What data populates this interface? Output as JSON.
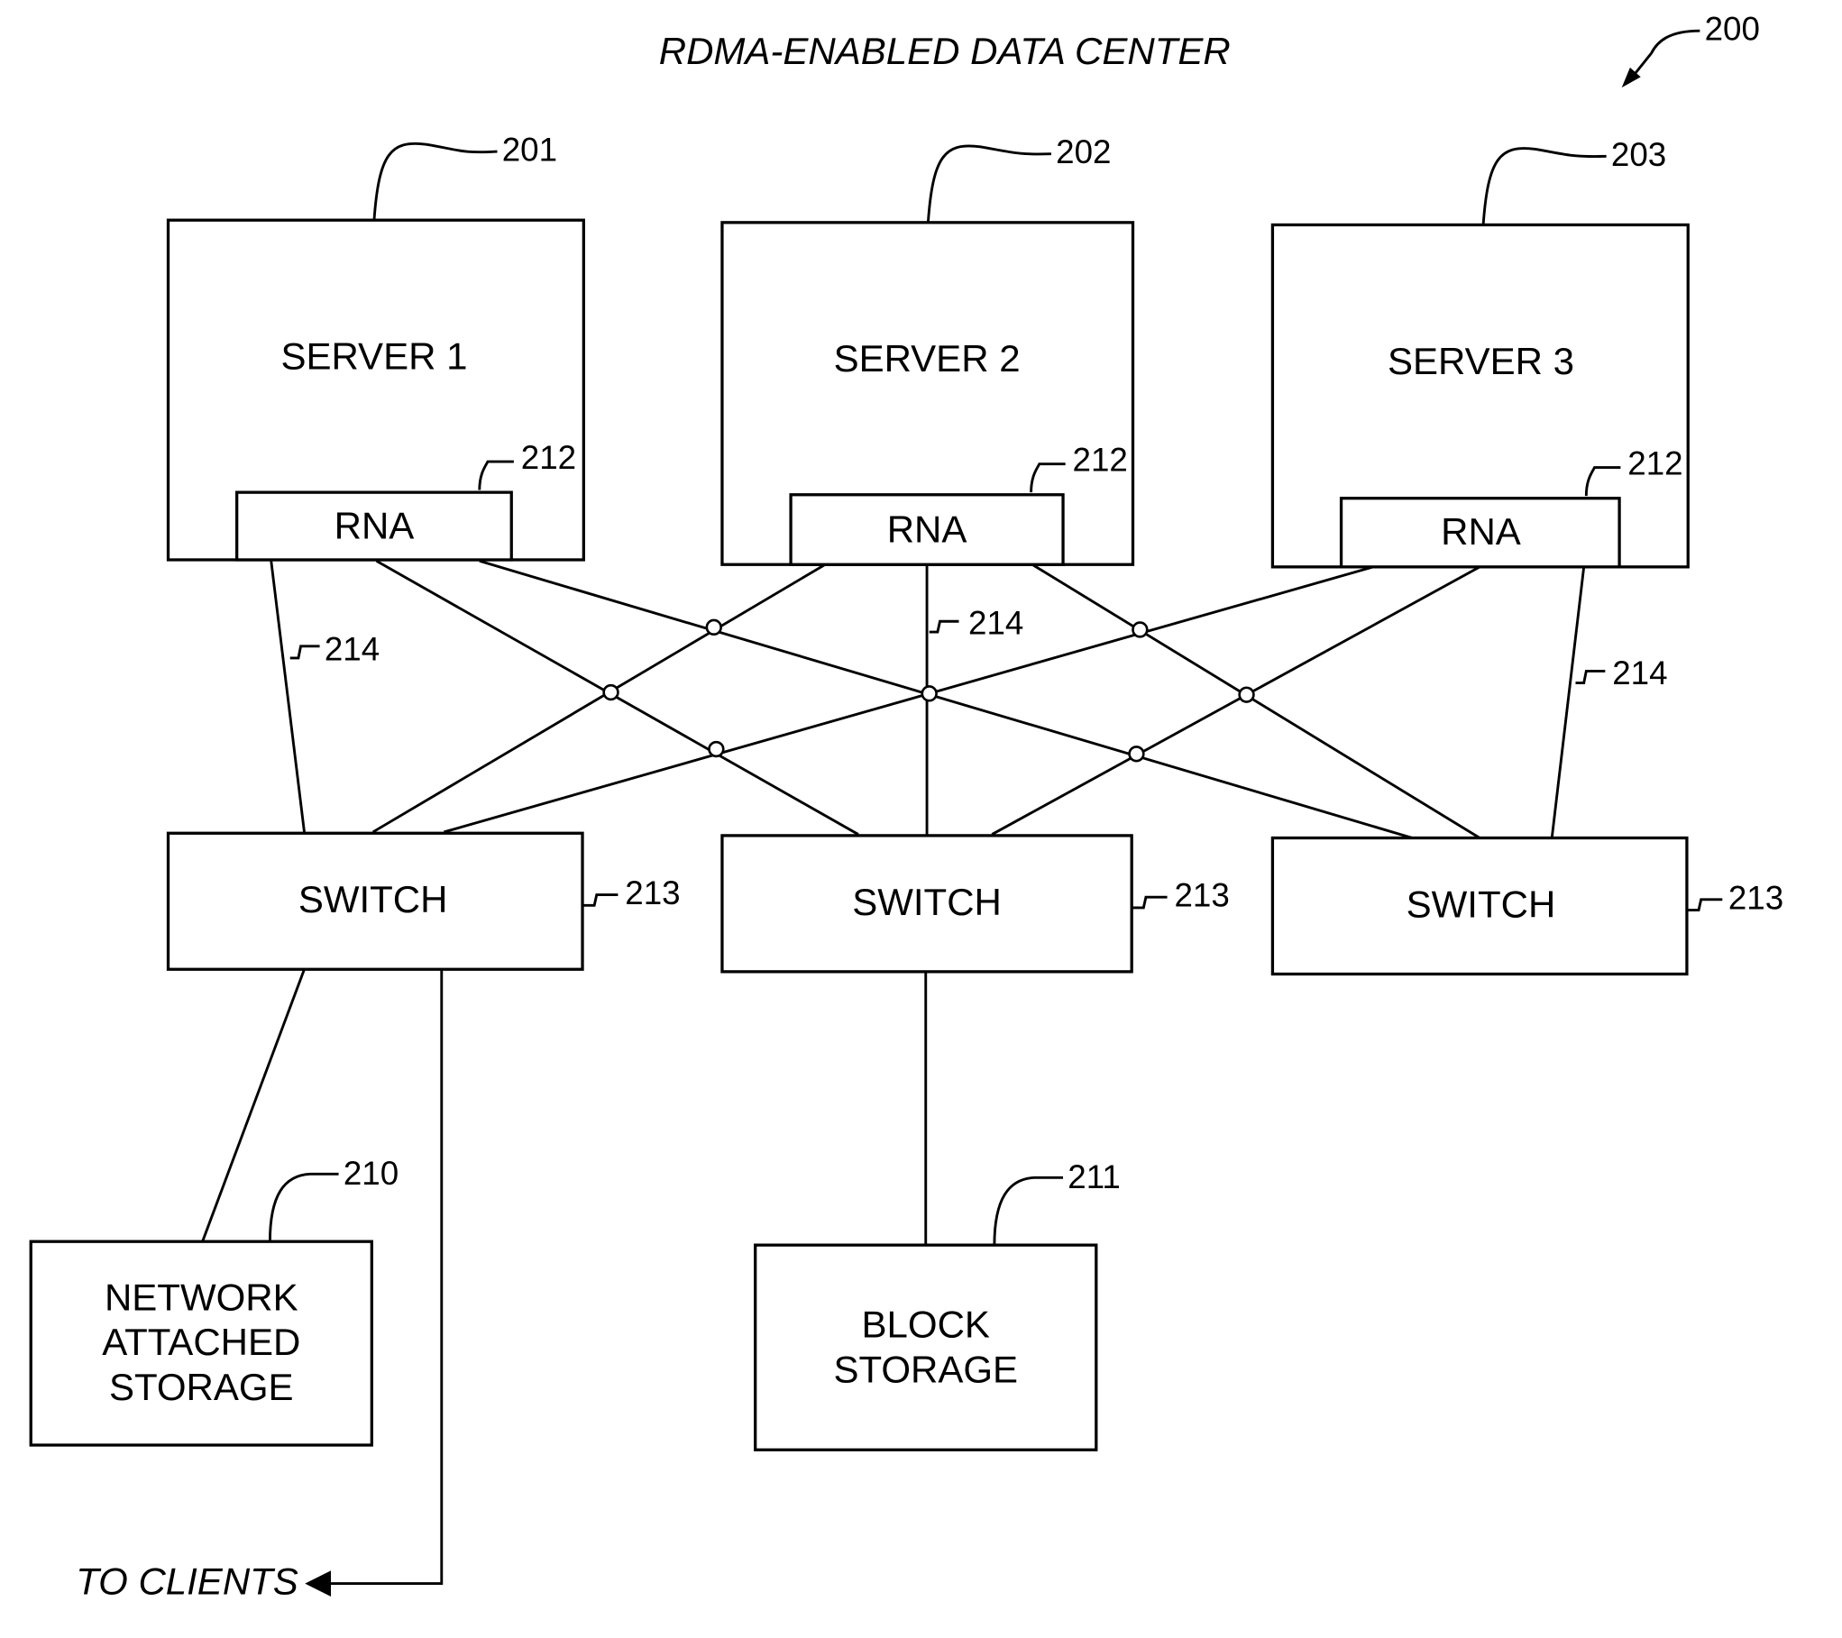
{
  "title": "RDMA-ENABLED DATA CENTER",
  "figure_ref": "200",
  "servers": [
    {
      "label": "SERVER 1",
      "ref": "201",
      "adapter_label": "RNA",
      "adapter_ref": "212"
    },
    {
      "label": "SERVER 2",
      "ref": "202",
      "adapter_label": "RNA",
      "adapter_ref": "212"
    },
    {
      "label": "SERVER 3",
      "ref": "203",
      "adapter_label": "RNA",
      "adapter_ref": "212"
    }
  ],
  "switches": [
    {
      "label": "SWITCH",
      "ref": "213"
    },
    {
      "label": "SWITCH",
      "ref": "213"
    },
    {
      "label": "SWITCH",
      "ref": "213"
    }
  ],
  "link_refs": [
    "214",
    "214",
    "214"
  ],
  "storage": [
    {
      "lines": [
        "NETWORK",
        "ATTACHED",
        "STORAGE"
      ],
      "ref": "210"
    },
    {
      "lines": [
        "BLOCK",
        "STORAGE"
      ],
      "ref": "211"
    }
  ],
  "clients_label": "TO CLIENTS"
}
